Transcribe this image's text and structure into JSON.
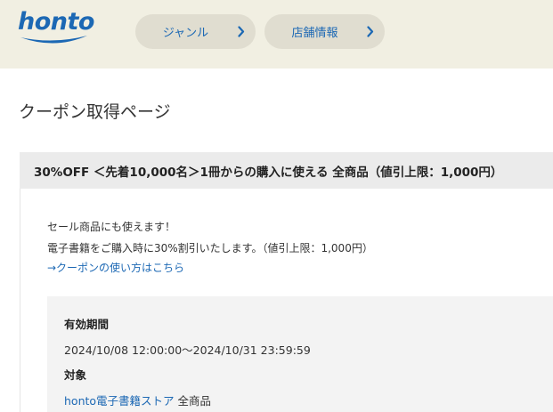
{
  "header": {
    "logo_text": "honto",
    "logo_color": "#1c68b4",
    "background": "#f1efe2",
    "nav": [
      {
        "label": "ジャンル",
        "icon": "chevron-right-icon"
      },
      {
        "label": "店舗情報",
        "icon": "chevron-right-icon"
      }
    ]
  },
  "page": {
    "title": "クーポン取得ページ"
  },
  "coupon": {
    "title": "30%OFF ＜先着10,000名＞1冊からの購入に使える 全商品（値引上限：1,000円）",
    "description_1": "セール商品にも使えます！",
    "description_2": "電子書籍をご購入時に30%割引いたします。（値引上限：1,000円）",
    "howto_link": "→クーポンの使い方はこちら",
    "period_label": "有効期間",
    "period_value": "2024/10/08 12:00:00～2024/10/31 23:59:59",
    "target_label": "対象",
    "target_store": "honto電子書籍ストア",
    "target_scope": " 全商品"
  },
  "colors": {
    "link": "#1c68b4",
    "coupon_bar": "#ebebeb",
    "info_box": "#f3f3f3"
  }
}
